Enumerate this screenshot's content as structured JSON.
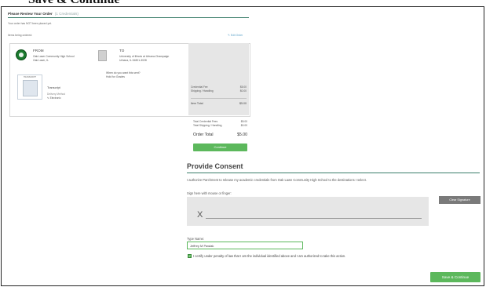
{
  "caption": "Save & Continue",
  "review": {
    "title": "Please Review Your Order",
    "count": "(1 Credentials)",
    "note": "Your order has NOT been placed yet.",
    "ordered_label": "Items being ordered:",
    "edit_label": "Edit Order"
  },
  "from": {
    "label": "FROM",
    "name": "Oak Lawn Community High School",
    "city": "Oak Lawn, IL"
  },
  "credential": {
    "thumb_label": "TRANSCRIPT",
    "title": "Transcript",
    "delivery_label": "Delivery Method",
    "delivery_value": "Electronic"
  },
  "to": {
    "label": "TO",
    "name": "University of Illinois at Urbana-Champaign",
    "address": "Urbana, IL 61801-3028",
    "when_question": "When do you want this sent?",
    "when_answer": "Hold for Grades"
  },
  "summary": {
    "credential_fee_label": "Credential Fee",
    "credential_fee": "$5.00",
    "shipping_label": "Shipping / Handling",
    "shipping": "$0.00",
    "item_total_label": "Item Total",
    "item_total": "$5.00",
    "total_credential_fees_label": "Total Credential Fees",
    "total_credential_fees": "$5.00",
    "total_shipping_label": "Total Shipping / Handling",
    "total_shipping": "$0.00",
    "order_total_label": "Order Total",
    "order_total": "$5.00",
    "continue_label": "Continue"
  },
  "consent": {
    "title": "Provide Consent",
    "text": "I authorize Parchment to release my academic credentials from Oak Lawn Community High School to the destinations I select.",
    "sign_label": "Sign here with mouse or finger:",
    "sign_x": "X",
    "clear_label": "Clear Signature",
    "type_name_label": "Type Name:",
    "type_name_value": "Jeffrey M Pawlak",
    "certify_text": "I certify under penalty of law that I am the individual identified above and I am authorized to take this action.",
    "save_label": "Save & Continue"
  },
  "colors": {
    "accent": "#3a7d6a",
    "button_green": "#5cb85c",
    "panel_gray": "#e6e6e6"
  }
}
